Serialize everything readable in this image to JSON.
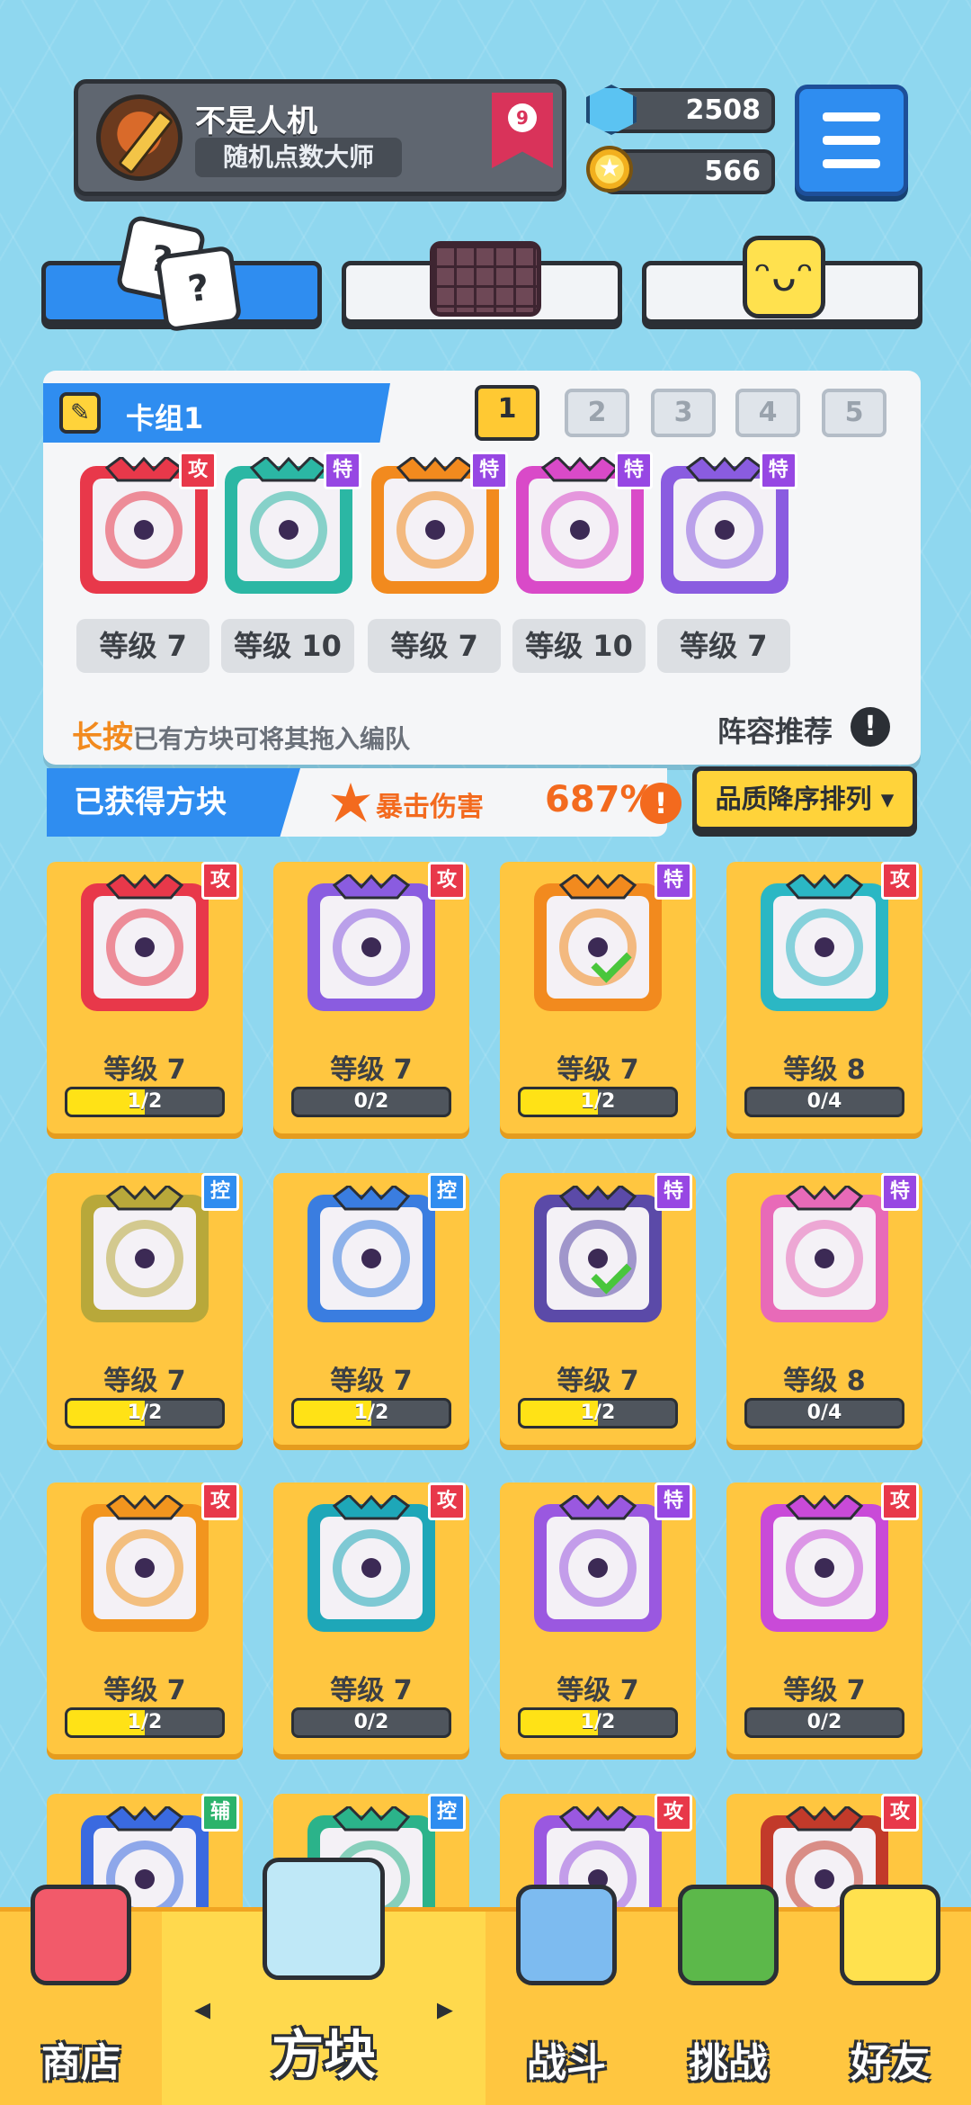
{
  "profile": {
    "name": "不是人机",
    "title": "随机点数大师",
    "rank": "9"
  },
  "currency": {
    "gems": "2508",
    "coins": "566"
  },
  "deck": {
    "title": "卡组1",
    "slots": [
      "1",
      "2",
      "3",
      "4",
      "5"
    ],
    "active_slot": "1",
    "cards": [
      {
        "badge": "攻",
        "level": "等级 7",
        "color": "#e8384a"
      },
      {
        "badge": "特",
        "level": "等级 10",
        "color": "#2bb7a4"
      },
      {
        "badge": "特",
        "level": "等级 7",
        "color": "#f28a1e"
      },
      {
        "badge": "特",
        "level": "等级 10",
        "color": "#d94ac8"
      },
      {
        "badge": "特",
        "level": "等级 7",
        "color": "#8a5ce0"
      }
    ],
    "hint_highlight": "长按",
    "hint_text": "已有方块可将其拖入编队",
    "recommend_label": "阵容推荐"
  },
  "obtained": {
    "label": "已获得方块",
    "crit_label": "暴击伤害",
    "crit_value": "687%",
    "sort_label": "品质降序排列 ▾"
  },
  "cards": [
    {
      "badge": "攻",
      "level": "等级 7",
      "progress": "1/2",
      "fill": 0.5,
      "color": "#e8384a",
      "check": false
    },
    {
      "badge": "攻",
      "level": "等级 7",
      "progress": "0/2",
      "fill": 0,
      "color": "#8a5ce0",
      "check": false
    },
    {
      "badge": "特",
      "level": "等级 7",
      "progress": "1/2",
      "fill": 0.5,
      "color": "#f28a1e",
      "check": true
    },
    {
      "badge": "攻",
      "level": "等级 8",
      "progress": "0/4",
      "fill": 0,
      "color": "#2bb7c4",
      "check": false
    },
    {
      "badge": "控",
      "level": "等级 7",
      "progress": "1/2",
      "fill": 0.5,
      "color": "#b8a83a",
      "check": false
    },
    {
      "badge": "控",
      "level": "等级 7",
      "progress": "1/2",
      "fill": 0.5,
      "color": "#3a7de0",
      "check": false
    },
    {
      "badge": "特",
      "level": "等级 7",
      "progress": "1/2",
      "fill": 0.5,
      "color": "#5b4aa8",
      "check": true
    },
    {
      "badge": "特",
      "level": "等级 8",
      "progress": "0/4",
      "fill": 0,
      "color": "#e86ab8",
      "check": false
    },
    {
      "badge": "攻",
      "level": "等级 7",
      "progress": "1/2",
      "fill": 0.5,
      "color": "#f2951e",
      "check": false
    },
    {
      "badge": "攻",
      "level": "等级 7",
      "progress": "0/2",
      "fill": 0,
      "color": "#1ea7b8",
      "check": false
    },
    {
      "badge": "特",
      "level": "等级 7",
      "progress": "1/2",
      "fill": 0.5,
      "color": "#9a58e0",
      "check": false
    },
    {
      "badge": "攻",
      "level": "等级 7",
      "progress": "0/2",
      "fill": 0,
      "color": "#c94ad8",
      "check": false
    },
    {
      "badge": "辅",
      "level": "",
      "progress": "",
      "fill": 0,
      "color": "#3a6ae0",
      "check": false
    },
    {
      "badge": "控",
      "level": "",
      "progress": "",
      "fill": 0,
      "color": "#2bb38a",
      "check": false
    },
    {
      "badge": "攻",
      "level": "",
      "progress": "",
      "fill": 0,
      "color": "#9a58e0",
      "check": false
    },
    {
      "badge": "攻",
      "level": "",
      "progress": "",
      "fill": 0,
      "color": "#c23a2a",
      "check": false
    }
  ],
  "nav": {
    "shop": "商店",
    "blocks": "方块",
    "battle": "战斗",
    "challenge": "挑战",
    "friends": "好友"
  }
}
